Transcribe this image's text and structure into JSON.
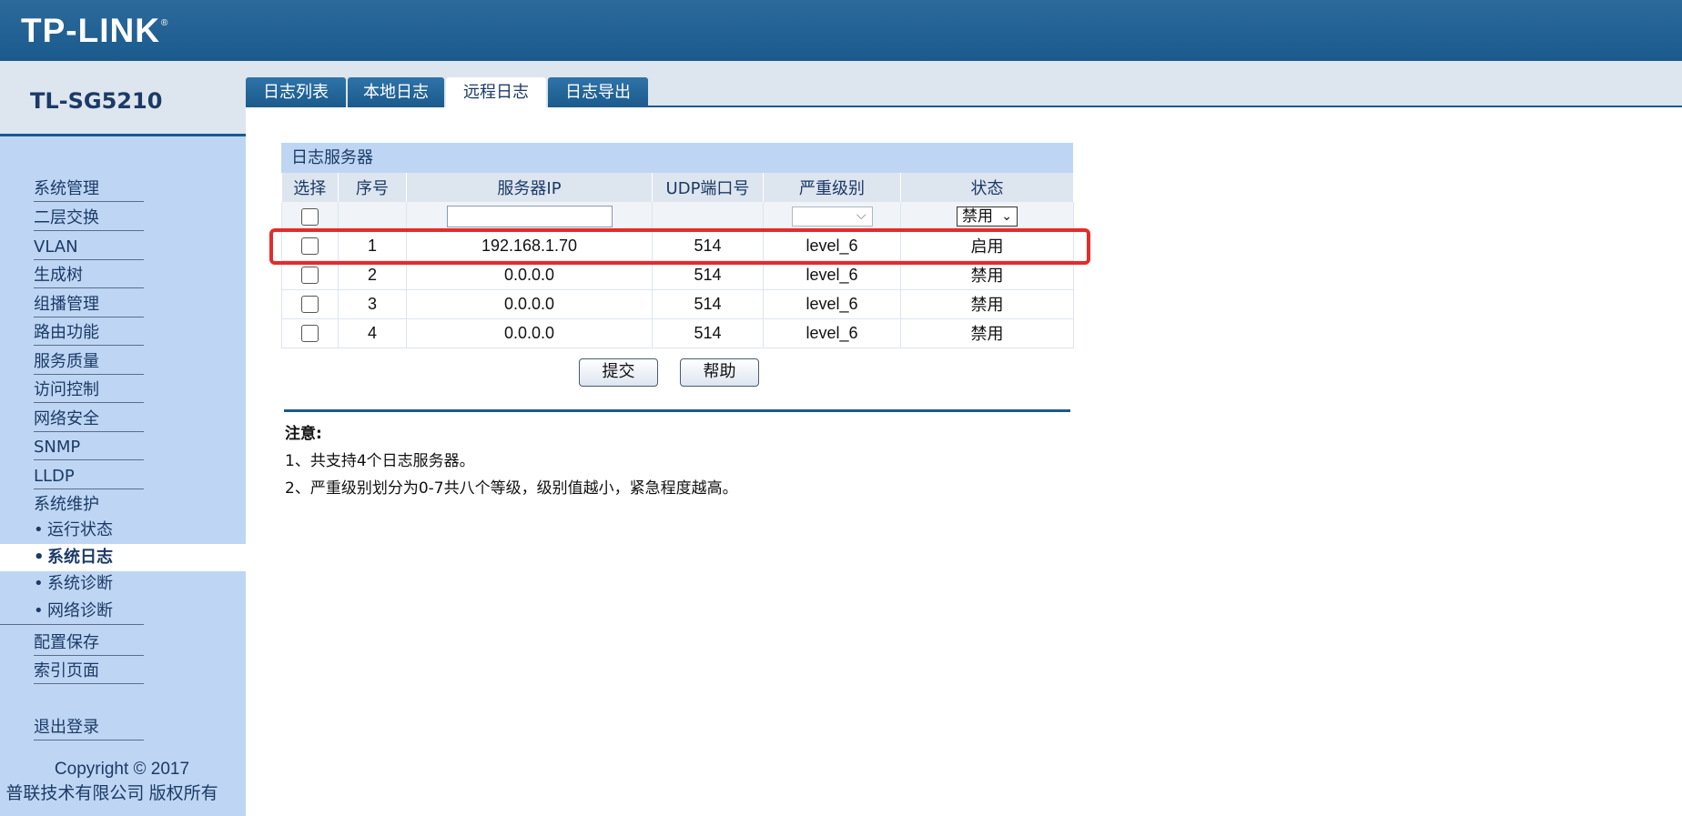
{
  "brand": {
    "logo_text": "TP-LINK",
    "registered": "®"
  },
  "sidebar": {
    "model": "TL-SG5210",
    "items": [
      {
        "label": "系统管理"
      },
      {
        "label": "二层交换"
      },
      {
        "label": "VLAN"
      },
      {
        "label": "生成树"
      },
      {
        "label": "组播管理"
      },
      {
        "label": "路由功能"
      },
      {
        "label": "服务质量"
      },
      {
        "label": "访问控制"
      },
      {
        "label": "网络安全"
      },
      {
        "label": "SNMP"
      },
      {
        "label": "LLDP"
      },
      {
        "label": "系统维护"
      }
    ],
    "sub_items": [
      {
        "label": "运行状态",
        "bullet": "•"
      },
      {
        "label": "系统日志",
        "bullet": "•",
        "active": true
      },
      {
        "label": "系统诊断",
        "bullet": "•"
      },
      {
        "label": "网络诊断",
        "bullet": "•"
      }
    ],
    "tail_items": [
      {
        "label": "配置保存"
      },
      {
        "label": "索引页面"
      }
    ],
    "logout": "退出登录",
    "copyright_line1": "Copyright © 2017",
    "copyright_line2": "普联技术有限公司 版权所有"
  },
  "tabs": [
    {
      "label": "日志列表"
    },
    {
      "label": "本地日志"
    },
    {
      "label": "远程日志",
      "active": true
    },
    {
      "label": "日志导出"
    }
  ],
  "panel": {
    "title": "日志服务器",
    "columns": [
      "选择",
      "序号",
      "服务器IP",
      "UDP端口号",
      "严重级别",
      "状态"
    ],
    "filter": {
      "ip_value": "",
      "level_value": "",
      "status_value": "禁用"
    },
    "rows": [
      {
        "index": "1",
        "ip": "192.168.1.70",
        "port": "514",
        "level": "level_6",
        "status": "启用"
      },
      {
        "index": "2",
        "ip": "0.0.0.0",
        "port": "514",
        "level": "level_6",
        "status": "禁用"
      },
      {
        "index": "3",
        "ip": "0.0.0.0",
        "port": "514",
        "level": "level_6",
        "status": "禁用"
      },
      {
        "index": "4",
        "ip": "0.0.0.0",
        "port": "514",
        "level": "level_6",
        "status": "禁用"
      }
    ]
  },
  "buttons": {
    "submit": "提交",
    "help": "帮助"
  },
  "notes": {
    "title": "注意:",
    "lines": [
      "1、共支持4个日志服务器。",
      "2、严重级别划分为0-7共八个等级，级别值越小，紧急程度越高。"
    ]
  },
  "colors": {
    "brand_blue": "#1b5a8c",
    "sidebar_bg": "#bed6f4",
    "highlight_red": "#e42b2b"
  }
}
